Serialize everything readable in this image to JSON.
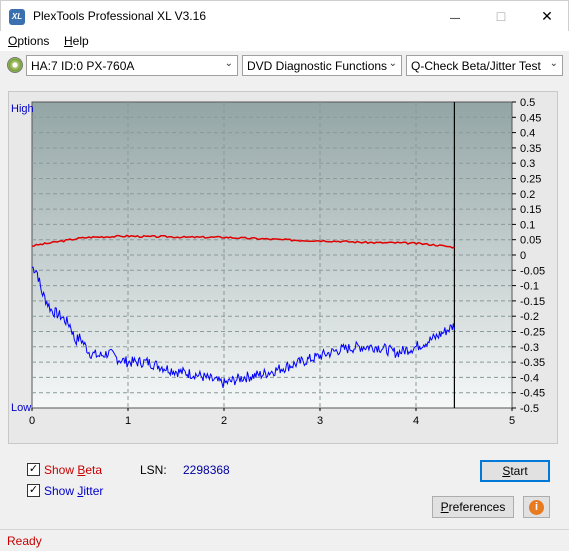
{
  "window": {
    "title": "PlexTools Professional XL V3.16",
    "app_icon_text": "XL",
    "minimize_glyph": "—",
    "maximize_glyph": "□",
    "close_glyph": "✕"
  },
  "menu": {
    "options": {
      "hot": "O",
      "rest": "ptions"
    },
    "help": {
      "hot": "H",
      "rest": "elp"
    }
  },
  "toolbar": {
    "drive": "HA:7 ID:0  PX-760A",
    "function": "DVD Diagnostic Functions",
    "test": "Q-Check Beta/Jitter Test",
    "dropdown_glyph": "⌄"
  },
  "chart_data": {
    "type": "line",
    "left_axis_labels": {
      "high": "High",
      "low": "Low"
    },
    "x_ticks": [
      "0",
      "1",
      "2",
      "3",
      "4",
      "5"
    ],
    "y_ticks": [
      "0.5",
      "0.45",
      "0.4",
      "0.35",
      "0.3",
      "0.25",
      "0.2",
      "0.15",
      "0.1",
      "0.05",
      "0",
      "-0.05",
      "-0.1",
      "-0.15",
      "-0.2",
      "-0.25",
      "-0.3",
      "-0.35",
      "-0.4",
      "-0.45",
      "-0.5"
    ],
    "xlim": [
      0,
      5
    ],
    "ylim": [
      -0.5,
      0.5
    ],
    "end_marker_x": 4.4,
    "grid": true,
    "colors": {
      "beta": "#e00000",
      "jitter": "#0000ff",
      "background_top": "#93a5a5",
      "background_bottom": "#f6f8f8",
      "grid": "#8a9999"
    },
    "series": [
      {
        "key": "beta",
        "x": [
          0,
          0.1,
          0.2,
          0.3,
          0.4,
          0.5,
          0.6,
          0.8,
          1.0,
          1.2,
          1.4,
          1.6,
          1.8,
          2.0,
          2.2,
          2.4,
          2.6,
          2.8,
          3.0,
          3.2,
          3.4,
          3.6,
          3.8,
          4.0,
          4.2,
          4.4
        ],
        "values": [
          0.03,
          0.035,
          0.04,
          0.045,
          0.05,
          0.055,
          0.058,
          0.06,
          0.062,
          0.06,
          0.06,
          0.058,
          0.058,
          0.058,
          0.055,
          0.053,
          0.05,
          0.048,
          0.047,
          0.045,
          0.042,
          0.04,
          0.04,
          0.038,
          0.033,
          0.025
        ]
      },
      {
        "key": "jitter",
        "x": [
          0,
          0.05,
          0.1,
          0.15,
          0.2,
          0.3,
          0.4,
          0.45,
          0.5,
          0.6,
          0.7,
          0.8,
          0.9,
          1.0,
          1.2,
          1.4,
          1.5,
          1.7,
          1.9,
          2.0,
          2.2,
          2.4,
          2.6,
          2.8,
          3.0,
          3.2,
          3.4,
          3.6,
          3.8,
          4.0,
          4.2,
          4.4
        ],
        "values": [
          -0.04,
          -0.05,
          -0.12,
          -0.15,
          -0.18,
          -0.2,
          -0.23,
          -0.28,
          -0.27,
          -0.32,
          -0.33,
          -0.32,
          -0.34,
          -0.35,
          -0.35,
          -0.37,
          -0.38,
          -0.39,
          -0.41,
          -0.42,
          -0.4,
          -0.39,
          -0.37,
          -0.35,
          -0.33,
          -0.31,
          -0.3,
          -0.3,
          -0.32,
          -0.3,
          -0.27,
          -0.23
        ]
      }
    ]
  },
  "options": {
    "show_beta": {
      "checked": true,
      "text": "Show ",
      "hot": "B",
      "rest": "eta",
      "color": "#c80000"
    },
    "show_jitter": {
      "checked": true,
      "text": "Show ",
      "hot": "J",
      "rest": "itter",
      "color": "#0000c8"
    },
    "lsn_label": "LSN:",
    "lsn_value": "2298368",
    "start_hot": "S",
    "start_rest": "tart",
    "preferences_hot": "P",
    "preferences_rest": "references",
    "check_glyph": "✓",
    "info_icon_glyph": "i"
  },
  "status": {
    "text": "Ready"
  }
}
